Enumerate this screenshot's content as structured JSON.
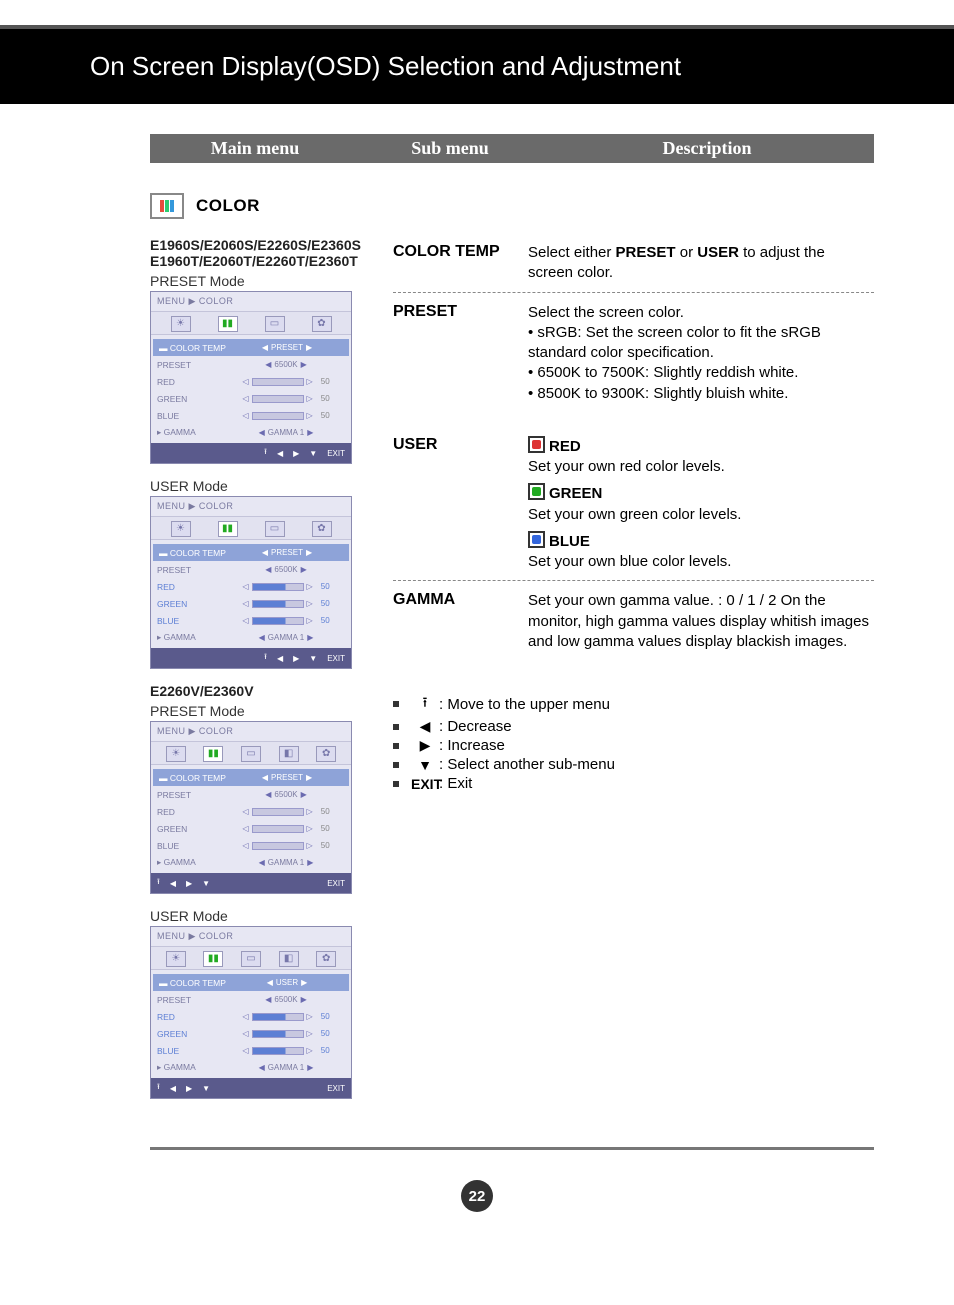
{
  "page_title": "On Screen Display(OSD) Selection and Adjustment",
  "header": {
    "col1": "Main menu",
    "col2": "Sub menu",
    "col3": "Description"
  },
  "section": {
    "label": "COLOR"
  },
  "models": {
    "group1_line1": "E1960S/E2060S/E2260S/E2360S",
    "group1_line2": "E1960T/E2060T/E2260T/E2360T",
    "group2": "E2260V/E2360V"
  },
  "mode_labels": {
    "preset": "PRESET Mode",
    "user": "USER Mode"
  },
  "osd": {
    "crumb": "MENU ▶ COLOR",
    "items": {
      "color_temp": "COLOR TEMP",
      "preset": "PRESET",
      "red": "RED",
      "green": "GREEN",
      "blue": "BLUE",
      "gamma": "GAMMA"
    },
    "values": {
      "preset_val": "PRESET",
      "user_val": "USER",
      "k6500": "6500K",
      "fifty": "50",
      "gamma1": "GAMMA 1"
    },
    "footer_exit": "EXIT"
  },
  "desc": {
    "color_temp": {
      "sub": "COLOR TEMP",
      "text_pre": "Select either ",
      "b1": "PRESET",
      "mid": " or ",
      "b2": "USER",
      "text_post": " to adjust the screen color."
    },
    "preset": {
      "sub": "PRESET",
      "line1": "Select the screen color.",
      "bullet1": "• sRGB: Set the screen color to fit the sRGB standard color specification.",
      "bullet2": "• 6500K to 7500K: Slightly reddish white.",
      "bullet3": "• 8500K to 9300K: Slightly bluish white."
    },
    "user": {
      "sub": "USER",
      "red_label": "RED",
      "red_text": "Set your own red color levels.",
      "green_label": "GREEN",
      "green_text": "Set your own green color levels.",
      "blue_label": "BLUE",
      "blue_text": "Set your own blue color levels."
    },
    "gamma": {
      "sub": "GAMMA",
      "text": "Set your own gamma value. : 0 / 1 / 2 On the monitor, high gamma values display whitish images and low gamma values display blackish images."
    }
  },
  "nav": {
    "up": ": Move to the upper menu",
    "left": ": Decrease",
    "right": ": Increase",
    "down": ": Select another sub-menu",
    "exit_label": "EXIT",
    "exit_text": ": Exit"
  },
  "page_number": "22"
}
